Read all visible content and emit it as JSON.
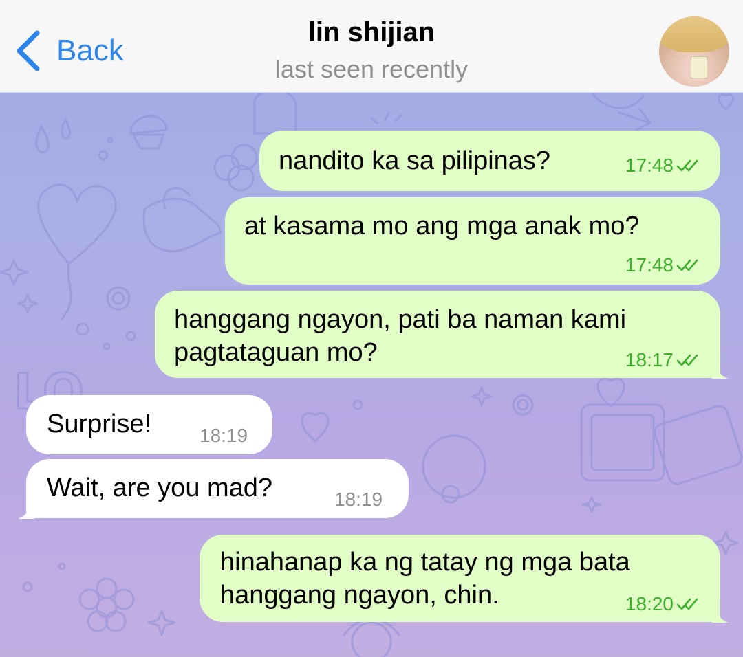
{
  "header": {
    "back_label": "Back",
    "contact_name": "lin shijian",
    "status": "last seen recently"
  },
  "icons": {
    "back": "chevron-left-icon",
    "read_receipt": "double-check-icon",
    "avatar": "contact-avatar"
  },
  "colors": {
    "accent": "#2f86ea",
    "outgoing_bubble": "#e1fec6",
    "incoming_bubble": "#ffffff",
    "outgoing_time": "#3fae2c",
    "incoming_time": "#8e8e93"
  },
  "messages": [
    {
      "direction": "outgoing",
      "text": "nandito ka sa pilipinas?",
      "time": "17:48",
      "read": true
    },
    {
      "direction": "outgoing",
      "text": "at kasama mo ang mga anak mo?",
      "time": "17:48",
      "read": true
    },
    {
      "direction": "outgoing",
      "text": "hanggang ngayon, pati ba naman kami\npagtataguan mo?",
      "time": "18:17",
      "read": true
    },
    {
      "direction": "incoming",
      "text": "Surprise!",
      "time": "18:19"
    },
    {
      "direction": "incoming",
      "text": "Wait, are you mad?",
      "time": "18:19"
    },
    {
      "direction": "outgoing",
      "text": "hinahanap ka ng tatay ng mga bata\nhanggang ngayon, chin.",
      "time": "18:20",
      "read": true
    }
  ]
}
